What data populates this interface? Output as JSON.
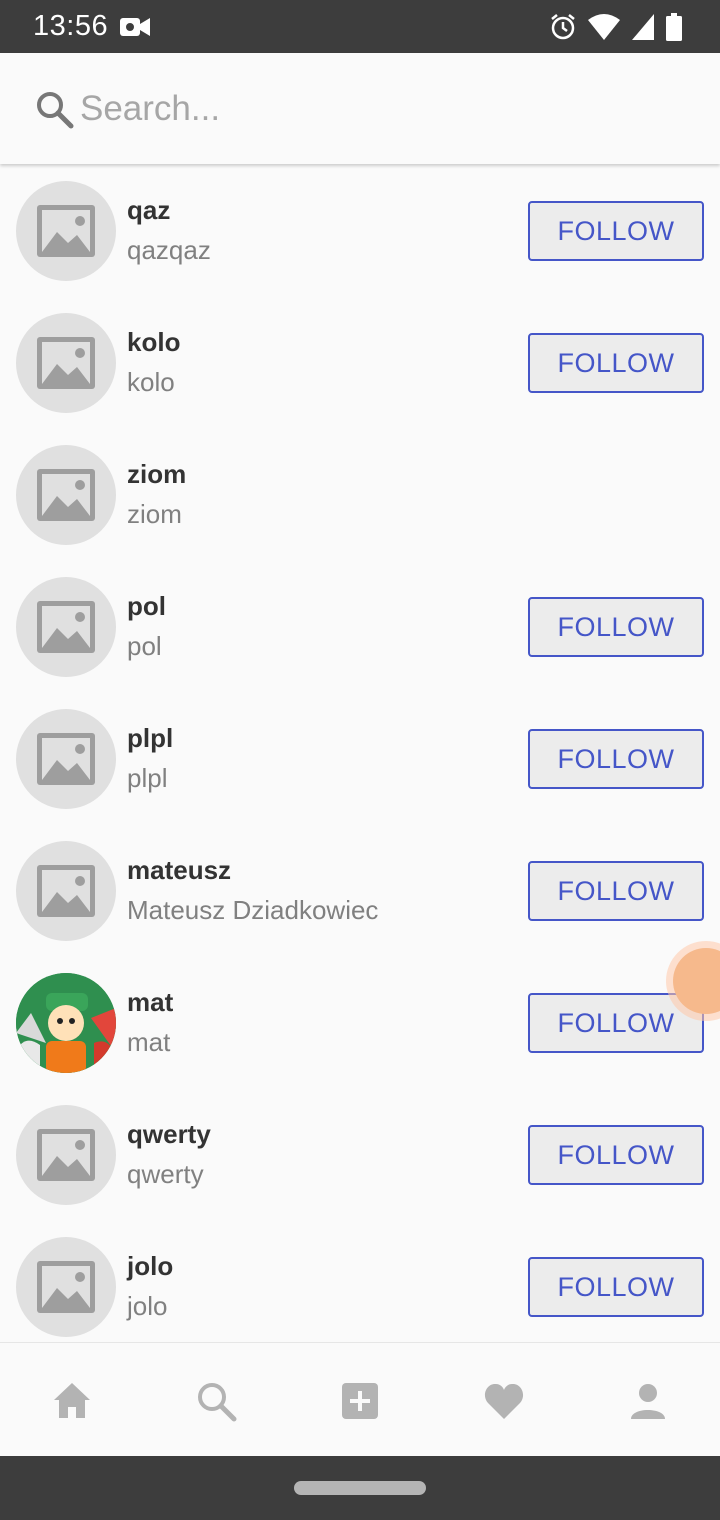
{
  "status_bar": {
    "time": "13:56",
    "icons": [
      "video-record-icon",
      "alarm-icon",
      "wifi-icon",
      "signal-icon",
      "battery-icon"
    ]
  },
  "search": {
    "placeholder": "Search...",
    "value": ""
  },
  "users": [
    {
      "username": "qaz",
      "name": "qazqaz",
      "follow_label": "FOLLOW",
      "avatar": "placeholder"
    },
    {
      "username": "kolo",
      "name": "kolo",
      "follow_label": "FOLLOW",
      "avatar": "placeholder"
    },
    {
      "username": "ziom",
      "name": "ziom",
      "follow_label": "",
      "avatar": "placeholder"
    },
    {
      "username": "pol",
      "name": "pol",
      "follow_label": "FOLLOW",
      "avatar": "placeholder"
    },
    {
      "username": "plpl",
      "name": "plpl",
      "follow_label": "FOLLOW",
      "avatar": "placeholder"
    },
    {
      "username": "mateusz",
      "name": "Mateusz Dziadkowiec",
      "follow_label": "FOLLOW",
      "avatar": "placeholder"
    },
    {
      "username": "mat",
      "name": "mat",
      "follow_label": "FOLLOW",
      "avatar": "photo"
    },
    {
      "username": "qwerty",
      "name": "qwerty",
      "follow_label": "FOLLOW",
      "avatar": "placeholder"
    },
    {
      "username": "jolo",
      "name": "jolo",
      "follow_label": "FOLLOW",
      "avatar": "placeholder"
    }
  ],
  "bottom_nav": {
    "items": [
      "home-icon",
      "search-icon",
      "add-post-icon",
      "heart-icon",
      "profile-icon"
    ]
  },
  "colors": {
    "accent": "#4556c8",
    "status_bar": "#3d3d3d",
    "background": "#fafafa",
    "avatar_placeholder": "#e0e0e0"
  }
}
